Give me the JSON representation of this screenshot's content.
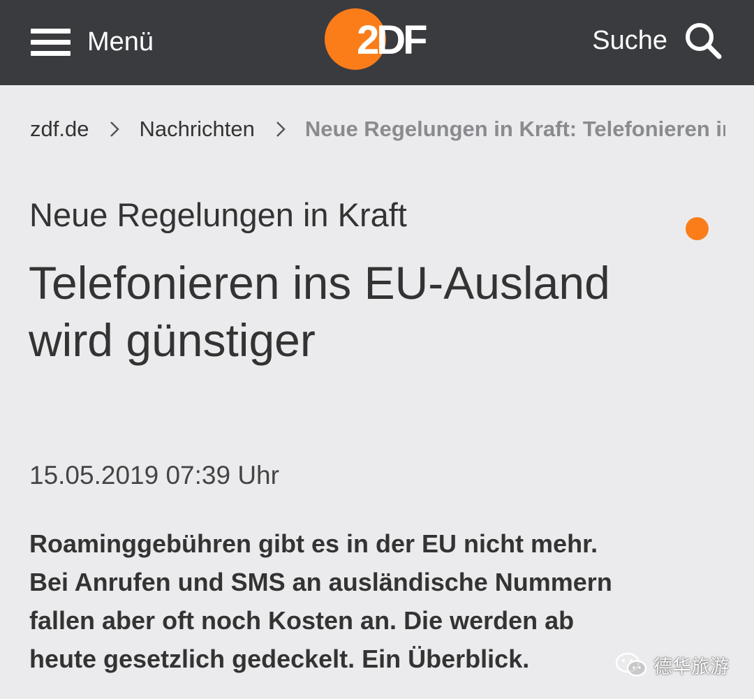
{
  "header": {
    "menu_label": "Menü",
    "logo_text": "2DF",
    "search_label": "Suche"
  },
  "breadcrumb": {
    "items": [
      "zdf.de",
      "Nachrichten"
    ],
    "current": "Neue Regelungen in Kraft: Telefonieren ins EU-Ausland wird günstiger"
  },
  "article": {
    "kicker": "Neue Regelungen in Kraft",
    "headline_line1": "Telefonieren ins EU-Ausland",
    "headline_line2": "wird günstiger",
    "timestamp": "15.05.2019 07:39 Uhr",
    "lead_lines": [
      "Roaminggebühren gibt es in der EU nicht mehr.",
      "Bei Anrufen und SMS an ausländische Nummern",
      "fallen aber oft noch Kosten an. Die werden ab",
      "heute gesetzlich gedeckelt. Ein Überblick."
    ]
  },
  "watermark": {
    "text": "德华旅游"
  },
  "colors": {
    "header_bg": "#3a3b3f",
    "page_bg": "#ebebed",
    "accent": "#fa7d19",
    "text": "#333333",
    "breadcrumb_current": "#8a8b8f"
  },
  "icons": [
    "hamburger-icon",
    "zdf-logo",
    "search-icon",
    "chevron-right-icon",
    "wechat-icon"
  ]
}
